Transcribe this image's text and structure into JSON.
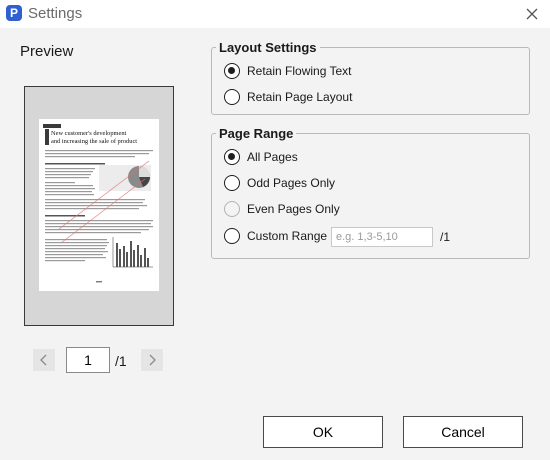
{
  "window": {
    "title": "Settings",
    "app_icon_letter": "P"
  },
  "preview": {
    "label": "Preview",
    "thumb": {
      "heading_line1": "New customer's development",
      "heading_line2": "and increasing the sale of product"
    },
    "current_page": "1",
    "total_pages": "/1"
  },
  "layout_settings": {
    "title": "Layout Settings",
    "options": [
      {
        "label": "Retain Flowing Text",
        "selected": true
      },
      {
        "label": "Retain Page Layout",
        "selected": false
      }
    ]
  },
  "page_range": {
    "title": "Page Range",
    "options": [
      {
        "label": "All Pages",
        "selected": true,
        "enabled": true
      },
      {
        "label": "Odd Pages Only",
        "selected": false,
        "enabled": true
      },
      {
        "label": "Even Pages Only",
        "selected": false,
        "enabled": false
      },
      {
        "label": "Custom Range",
        "selected": false,
        "enabled": true
      }
    ],
    "custom_placeholder": "e.g. 1,3-5,10",
    "custom_total": "/1"
  },
  "buttons": {
    "ok": "OK",
    "cancel": "Cancel"
  },
  "colors": {
    "app_icon": "#2f5fd0",
    "background": "#f3f3f3",
    "preview_bg": "#d6d6d6"
  }
}
